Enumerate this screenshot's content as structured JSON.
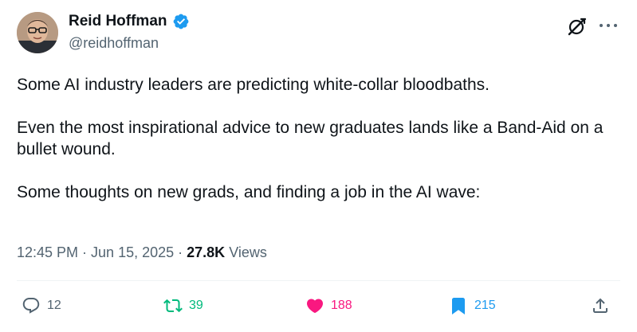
{
  "author": {
    "name": "Reid Hoffman",
    "handle": "@reidhoffman",
    "verified": true
  },
  "tweet": {
    "paragraphs": [
      "Some AI industry leaders are predicting white-collar bloodbaths.",
      "Even the most inspirational advice to new graduates lands like a Band-Aid on a bullet wound.",
      "Some thoughts on new grads, and finding a job in the AI wave:"
    ],
    "time": "12:45 PM",
    "date": "Jun 15, 2025",
    "separator": "·",
    "views_count": "27.8K",
    "views_label": "Views"
  },
  "actions": {
    "replies": "12",
    "reposts": "39",
    "likes": "188",
    "bookmarks": "215"
  },
  "colors": {
    "verified": "#1d9bf0",
    "repost_active": "#00ba7c",
    "like_active": "#f91880",
    "bookmark_active": "#1d9bf0",
    "secondary_text": "#536471"
  },
  "icons": [
    "verified-badge-icon",
    "grok-icon",
    "more-icon",
    "reply-icon",
    "repost-icon",
    "heart-icon",
    "bookmark-icon",
    "share-icon"
  ]
}
